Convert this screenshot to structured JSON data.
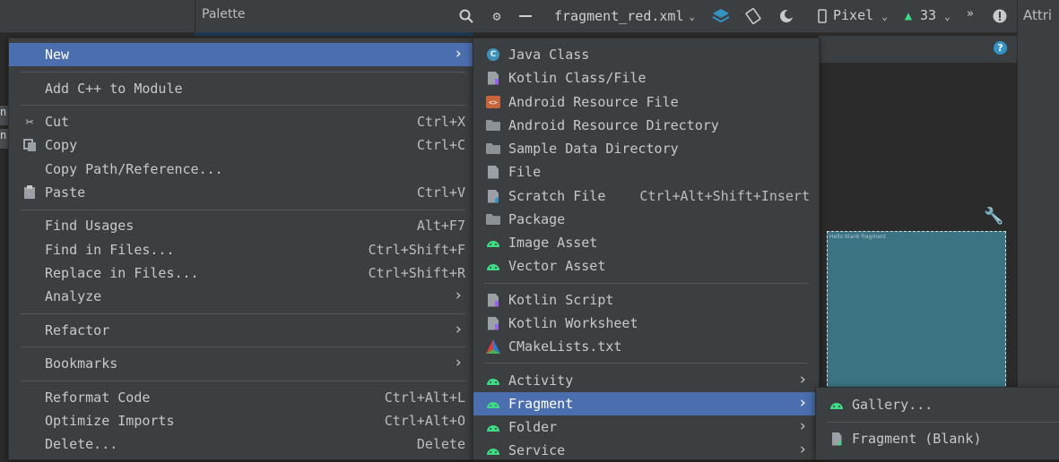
{
  "toolbar": {
    "palette_title": "Palette",
    "file_tab": "fragment_red.xml",
    "device": "Pixel",
    "api_level": "33",
    "attributes_title": "Attri",
    "overflow": "»"
  },
  "preview": {
    "text": "Hello blank fragment"
  },
  "left_edge": {
    "tab1": "n",
    "tab2": "n"
  },
  "main_menu": {
    "items": [
      {
        "label": "New",
        "submenu": true,
        "selected": true
      },
      {
        "label": "Add C++ to Module"
      },
      {
        "label": "Cut",
        "shortcut": "Ctrl+X",
        "icon": "scissors-icon"
      },
      {
        "label": "Copy",
        "shortcut": "Ctrl+C",
        "icon": "copy-icon"
      },
      {
        "label": "Copy Path/Reference..."
      },
      {
        "label": "Paste",
        "shortcut": "Ctrl+V",
        "icon": "clipboard-icon"
      },
      {
        "label": "Find Usages",
        "shortcut": "Alt+F7"
      },
      {
        "label": "Find in Files...",
        "shortcut": "Ctrl+Shift+F"
      },
      {
        "label": "Replace in Files...",
        "shortcut": "Ctrl+Shift+R"
      },
      {
        "label": "Analyze",
        "submenu": true
      },
      {
        "label": "Refactor",
        "submenu": true
      },
      {
        "label": "Bookmarks",
        "submenu": true
      },
      {
        "label": "Reformat Code",
        "shortcut": "Ctrl+Alt+L"
      },
      {
        "label": "Optimize Imports",
        "shortcut": "Ctrl+Alt+O"
      },
      {
        "label": "Delete...",
        "shortcut": "Delete"
      }
    ]
  },
  "new_menu": {
    "items": [
      {
        "label": "Java Class"
      },
      {
        "label": "Kotlin Class/File"
      },
      {
        "label": "Android Resource File"
      },
      {
        "label": "Android Resource Directory"
      },
      {
        "label": "Sample Data Directory"
      },
      {
        "label": "File"
      },
      {
        "label": "Scratch File",
        "shortcut": "Ctrl+Alt+Shift+Insert"
      },
      {
        "label": "Package"
      },
      {
        "label": "Image Asset"
      },
      {
        "label": "Vector Asset"
      },
      {
        "label": "Kotlin Script"
      },
      {
        "label": "Kotlin Worksheet"
      },
      {
        "label": "CMakeLists.txt"
      },
      {
        "label": "Activity",
        "submenu": true
      },
      {
        "label": "Fragment",
        "submenu": true,
        "selected": true
      },
      {
        "label": "Folder",
        "submenu": true
      },
      {
        "label": "Service",
        "submenu": true
      }
    ]
  },
  "fragment_menu": {
    "items": [
      {
        "label": "Gallery..."
      },
      {
        "label": "Fragment (Blank)"
      }
    ]
  },
  "colors": {
    "selection": "#4b6eaf",
    "menu_bg": "#3c3f41",
    "android_green": "#3ddc84",
    "preview_bg": "#3b7383"
  }
}
